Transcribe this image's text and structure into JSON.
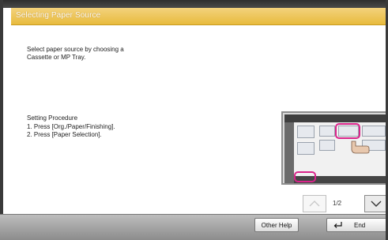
{
  "window": {
    "title": "Selecting Paper Source"
  },
  "content": {
    "intro_line1": "Select paper source by choosing a",
    "intro_line2": "Cassette or MP Tray.",
    "procedure_title": "Setting Procedure",
    "steps": [
      "1. Press [Org./Paper/Finishing].",
      "2. Press [Paper Selection]."
    ]
  },
  "pager": {
    "page": "1/2"
  },
  "footer": {
    "other_help_label": "Other Help",
    "end_label": "End"
  },
  "colors": {
    "accent": "#e8bb3d",
    "highlight": "#d9238a"
  }
}
